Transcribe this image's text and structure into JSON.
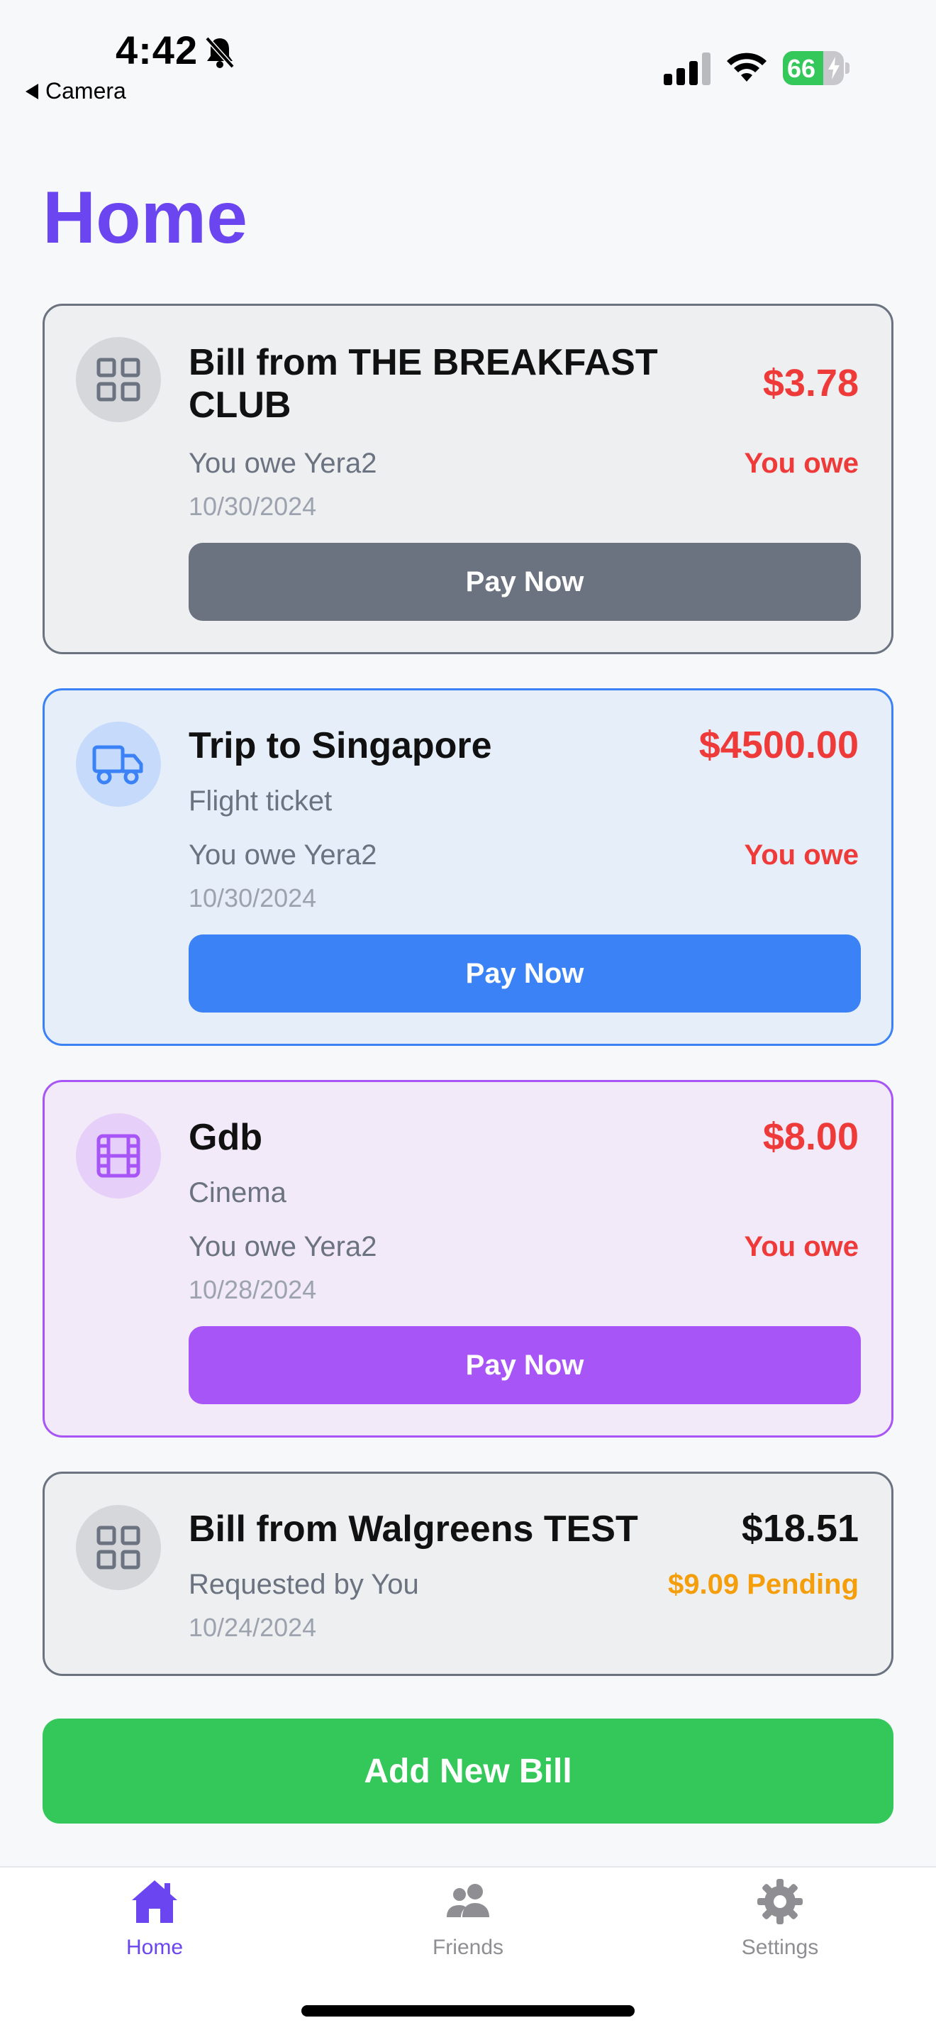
{
  "status_bar": {
    "time": "4:42",
    "back_label": "Camera",
    "battery_percent": "66",
    "battery_level": 0.66
  },
  "page": {
    "title": "Home"
  },
  "bills": [
    {
      "title_line1": "Bill from THE BREAKFAST",
      "title_line2": "CLUB",
      "amount": "$3.78",
      "subtitle": "You owe Yera2",
      "status": "You owe",
      "date": "10/30/2024",
      "button": "Pay Now",
      "icon": "grid-icon",
      "theme": "grey"
    },
    {
      "title": "Trip to Singapore",
      "amount": "$4500.00",
      "category": "Flight ticket",
      "subtitle": "You owe Yera2",
      "status": "You owe",
      "date": "10/30/2024",
      "button": "Pay Now",
      "icon": "truck-icon",
      "theme": "blue"
    },
    {
      "title": "Gdb",
      "amount": "$8.00",
      "category": "Cinema",
      "subtitle": "You owe Yera2",
      "status": "You owe",
      "date": "10/28/2024",
      "button": "Pay Now",
      "icon": "film-icon",
      "theme": "purple"
    },
    {
      "title": "Bill from Walgreens TEST",
      "amount": "$18.51",
      "subtitle": "Requested by You",
      "status": "$9.09 Pending",
      "date": "10/24/2024",
      "icon": "grid-icon",
      "theme": "grey"
    }
  ],
  "add_button": "Add New Bill",
  "tabs": [
    {
      "label": "Home",
      "icon": "home-icon",
      "active": true
    },
    {
      "label": "Friends",
      "icon": "friends-icon",
      "active": false
    },
    {
      "label": "Settings",
      "icon": "gear-icon",
      "active": false
    }
  ],
  "colors": {
    "accent": "#6b46f0",
    "owe_red": "#ef3a3a",
    "pending_orange": "#f59e0b",
    "add_green": "#34c759",
    "blue": "#3b82f6",
    "purple": "#a855f7",
    "grey": "#6b7280"
  }
}
